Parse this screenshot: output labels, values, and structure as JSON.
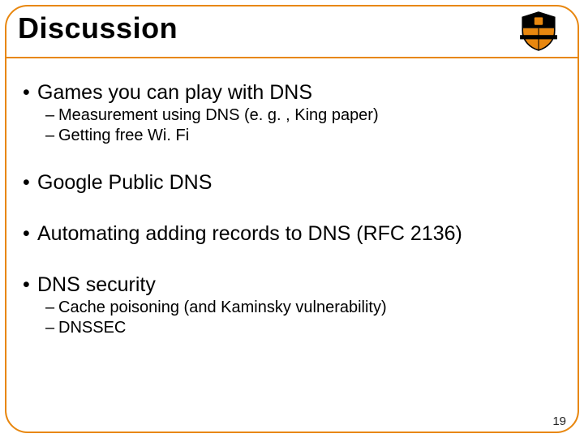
{
  "title": "Discussion",
  "page_number": "19",
  "bullets": {
    "b1": "Games you can play with DNS",
    "b1s1": "Measurement using DNS (e. g. , King paper)",
    "b1s2": "Getting free Wi. Fi",
    "b2": "Google Public DNS",
    "b3": "Automating adding records to DNS (RFC 2136)",
    "b4": "DNS security",
    "b4s1": "Cache poisoning (and Kaminsky vulnerability)",
    "b4s2": "DNSSEC"
  }
}
